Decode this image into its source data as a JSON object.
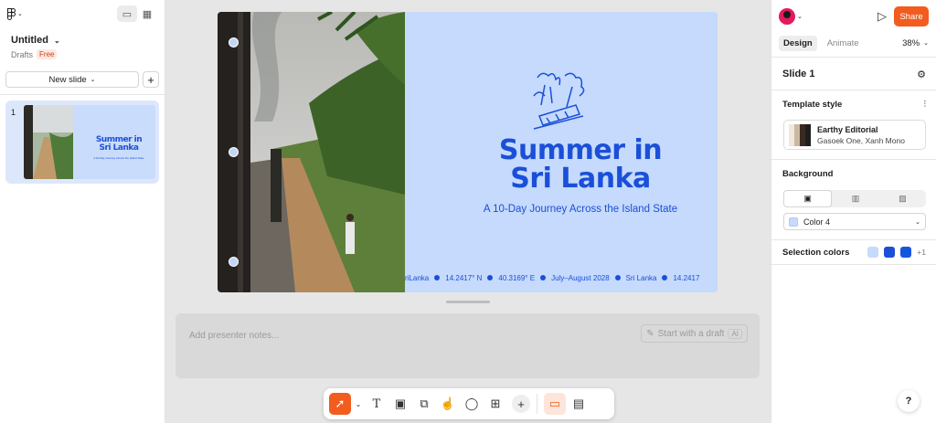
{
  "app": {
    "logo_icon": "figma-logo-icon"
  },
  "file": {
    "title": "Untitled",
    "location": "Drafts",
    "plan_badge": "Free"
  },
  "left_panel": {
    "new_slide_label": "New slide",
    "slides": [
      {
        "number": "1"
      }
    ]
  },
  "slide": {
    "title_line1": "Summer in",
    "title_line2": "Sri Lanka",
    "subtitle": "A 10-Day Journey Across the Island State",
    "ticker": [
      "Sri Lanka",
      "14.2417° N",
      "40.3169° E",
      "July–August 2028",
      "Sri Lanka",
      "14.2417"
    ],
    "ticker_partial_start": "riLanka",
    "background_color": "#c5dafc",
    "accent_color": "#1b4fd8"
  },
  "notes": {
    "placeholder": "Add presenter notes...",
    "draft_button": "Start with a draft",
    "ai_tag": "AI"
  },
  "right_panel": {
    "share_label": "Share",
    "tabs": [
      "Design",
      "Animate"
    ],
    "zoom": "38%",
    "slide_name": "Slide 1",
    "template_style_label": "Template style",
    "template": {
      "name": "Earthy Editorial",
      "fonts": "Gasoek One, Xanh Mono",
      "swatches": [
        "#efe8dc",
        "#c9b9a0",
        "#3a2a22",
        "#1e1e1e"
      ]
    },
    "background_label": "Background",
    "background_value": "Color 4",
    "selection_colors_label": "Selection colors",
    "selection_colors": [
      "#c5dafc",
      "#1b4fd8",
      "#1556e0"
    ],
    "selection_colors_more": "+1"
  },
  "help_label": "?"
}
